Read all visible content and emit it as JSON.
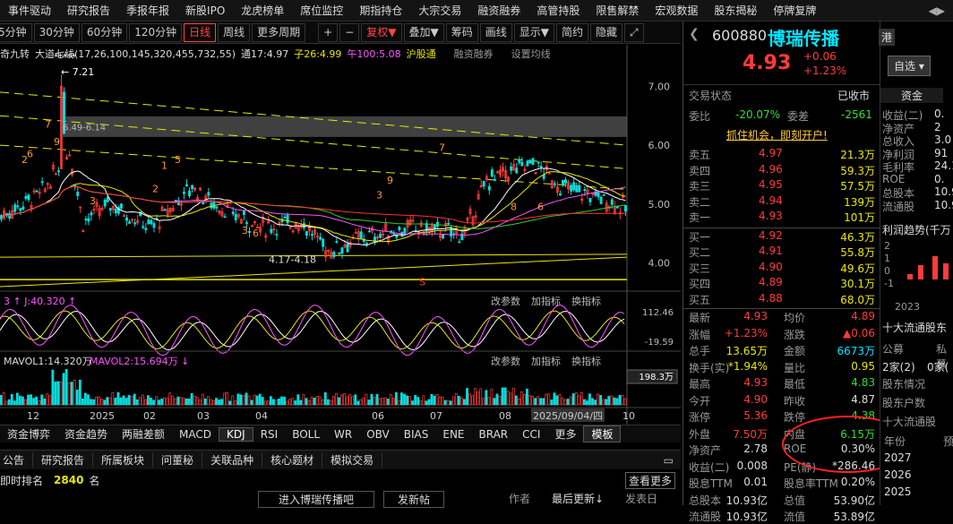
{
  "menu": [
    "事件驱动",
    "研究报告",
    "季报年报",
    "新股IPO",
    "龙虎榜单",
    "席位监控",
    "期指持仓",
    "大宗交易",
    "融资融券",
    "高管持股",
    "限售解禁",
    "宏观数据",
    "股东揭秘",
    "停牌复牌"
  ],
  "toolbar": {
    "periods": [
      "5分钟",
      "30分钟",
      "60分钟",
      "120分钟",
      "日线",
      "周线",
      "更多周期"
    ],
    "buttons": [
      "+",
      "−",
      "复权",
      "叠加",
      "筹码",
      "画线",
      "显示",
      "简约",
      "隐藏"
    ]
  },
  "chart_header": {
    "name": "奇九转",
    "ma_label": "大道七线(17,26,100,145,320,455,732,55)",
    "tong": "通17:4.97",
    "zi": "子26:4.99",
    "wu": "午100:5.08",
    "hugutong": "沪股通",
    "rzrq": "融资融券",
    "setting": "设置均线"
  },
  "price_axis": [
    "7.00",
    "6.00",
    "5.00",
    "4.00"
  ],
  "annotations": {
    "high": "7.21",
    "range_hi": "6.49-6.14",
    "low": "4.17-4.18",
    "s_mark": "S"
  },
  "kdj": {
    "j_label": "J:40.320",
    "prefix": "3",
    "axis_top": "112.46",
    "axis_bot": "-19.59",
    "ctrl": [
      "改参数",
      "加指标",
      "换指标"
    ]
  },
  "vol": {
    "mavol1": "MAVOL1:14.320万",
    "mavol2": "MAVOL2:15.694万",
    "axis": "198.3万",
    "ctrl": [
      "改参数",
      "加指标",
      "换指标"
    ]
  },
  "time_axis": [
    "12",
    "2025",
    "02",
    "03",
    "04",
    "06",
    "07",
    "08",
    "2025/09/04/四",
    "10"
  ],
  "indicator_tabs": [
    "资金博弈",
    "资金趋势",
    "两融差额",
    "MACD",
    "KDJ",
    "RSI",
    "BOLL",
    "WR",
    "OBV",
    "BIAS",
    "ENE",
    "BRAR",
    "CCI",
    "更多",
    "模板"
  ],
  "lower_tabs": [
    "公告",
    "研究报告",
    "所属板块",
    "问董秘",
    "关联品种",
    "核心题材",
    "模拟交易"
  ],
  "rank": {
    "label": "即时排名",
    "value": "2840",
    "unit": "名",
    "btn": "查看更多"
  },
  "post": {
    "enter": "进入博瑞传播吧",
    "post": "发新帖",
    "author": "作者",
    "update": "最后更新↓",
    "publish": "发表日"
  },
  "stock": {
    "code": "600880",
    "name": "博瑞传播",
    "price": "4.93",
    "chg": "+0.06",
    "pct": "+1.23%",
    "tag1": "融",
    "tag2": "港",
    "select": "自选"
  },
  "status": {
    "label": "交易状态",
    "value": "已收市"
  },
  "weibi": {
    "wb": "委比",
    "wb_v": "-20.07%",
    "wc": "委差",
    "wc_v": "-2561"
  },
  "ad": "抓住机会，即刻开户!",
  "sell": [
    {
      "l": "卖五",
      "p": "4.97",
      "v": "21.3万"
    },
    {
      "l": "卖四",
      "p": "4.96",
      "v": "59.3万"
    },
    {
      "l": "卖三",
      "p": "4.95",
      "v": "57.5万"
    },
    {
      "l": "卖二",
      "p": "4.94",
      "v": "139万"
    },
    {
      "l": "卖一",
      "p": "4.93",
      "v": "101万"
    }
  ],
  "buy": [
    {
      "l": "买一",
      "p": "4.92",
      "v": "46.3万"
    },
    {
      "l": "买二",
      "p": "4.91",
      "v": "55.8万"
    },
    {
      "l": "买三",
      "p": "4.90",
      "v": "49.6万"
    },
    {
      "l": "买四",
      "p": "4.89",
      "v": "30.1万"
    },
    {
      "l": "买五",
      "p": "4.88",
      "v": "68.0万"
    }
  ],
  "stats": [
    {
      "a": "最新",
      "av": "4.93",
      "b": "均价",
      "bv": "4.89"
    },
    {
      "a": "涨幅",
      "av": "+1.23%",
      "b": "涨跌",
      "bv": "▲0.06"
    },
    {
      "a": "总手",
      "av": "13.65万",
      "b": "金额",
      "bv": "6673万"
    },
    {
      "a": "换手(实)",
      "av": "*1.94%",
      "b": "量比",
      "bv": "0.95"
    },
    {
      "a": "最高",
      "av": "4.93",
      "b": "最低",
      "bv": "4.83"
    },
    {
      "a": "今开",
      "av": "4.90",
      "b": "昨收",
      "bv": "4.87"
    },
    {
      "a": "涨停",
      "av": "5.36",
      "b": "跌停",
      "bv": "4.38"
    },
    {
      "a": "外盘",
      "av": "7.50万",
      "b": "内盘",
      "bv": "6.15万"
    },
    {
      "a": "净资产",
      "av": "2.78",
      "b": "ROE",
      "bv": "0.30%"
    },
    {
      "a": "收益(二)",
      "av": "0.008",
      "b": "PE(静)",
      "bv": "*286.46"
    },
    {
      "a": "股息TTM",
      "av": "0.01",
      "b": "股息率TTM",
      "bv": "0.20%"
    },
    {
      "a": "总股本",
      "av": "10.93亿",
      "b": "总值",
      "bv": "53.90亿"
    },
    {
      "a": "流通股",
      "av": "10.93亿",
      "b": "流值",
      "bv": "53.89亿"
    }
  ],
  "side": {
    "tab1": "资金",
    "rows": [
      "收益(二)",
      "净资产",
      "总收入",
      "净利润",
      "毛利率",
      "ROE",
      "总股本",
      "流通股"
    ],
    "vals": [
      "0.",
      "2",
      "3.0",
      "91",
      "24.1",
      "0.",
      "10.9",
      "10.9"
    ],
    "trend": "利润趋势(千万",
    "axis": [
      "2",
      "1",
      "0",
      "-1"
    ],
    "year": "2023",
    "top10": "十大流通股东",
    "h1": "公募",
    "h2": "私募",
    "h3": "2家(2)",
    "h4": "0家(",
    "gd1": "股东情况",
    "gd2": "股东户数",
    "gd3": "十大流通股",
    "yr": "年份",
    "yr2": "预",
    "years": [
      "2027",
      "2026",
      "2025"
    ]
  },
  "colors": {
    "up": "#ff3b3b",
    "down": "#33dd33",
    "accent": "#00e5ff"
  },
  "chart_data": {
    "type": "candlestick",
    "x": [
      "12",
      "2025",
      "02",
      "03",
      "04",
      "06",
      "07",
      "08",
      "2025/09/04/四",
      "10"
    ],
    "ylim": [
      3.6,
      7.4
    ],
    "ma": {
      "17": 4.97,
      "26": 4.99,
      "100": 5.08
    },
    "kdj": {
      "J": 40.32
    },
    "volume": {
      "MAVOL1": "14.320万",
      "MAVOL2": "15.694万"
    }
  }
}
